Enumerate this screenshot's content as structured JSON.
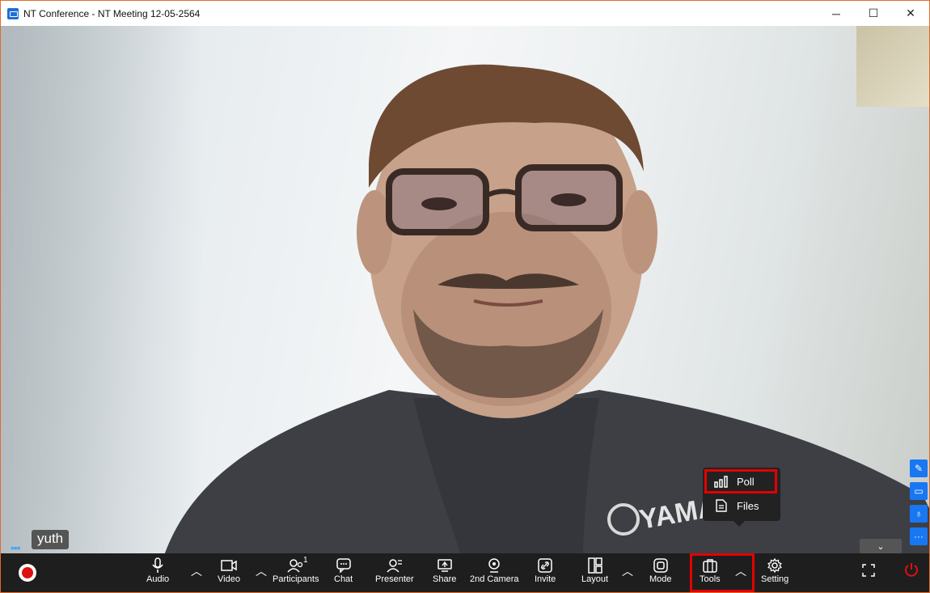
{
  "window": {
    "title": "NT Conference - NT Meeting 12-05-2564",
    "minimize": "─",
    "maximize": "☐",
    "close": "✕"
  },
  "participant": {
    "name": "yuth",
    "indicator": "•••"
  },
  "side_buttons": [
    {
      "name": "pin-icon",
      "glyph": "✎"
    },
    {
      "name": "camera-icon",
      "glyph": "▭"
    },
    {
      "name": "mic-icon",
      "glyph": "♁"
    },
    {
      "name": "more-icon",
      "glyph": "···"
    }
  ],
  "collapse_label": "⌄",
  "tools_menu": {
    "items": [
      {
        "label": "Poll",
        "icon": "bar-chart-icon"
      },
      {
        "label": "Files",
        "icon": "file-icon"
      }
    ]
  },
  "toolbar": {
    "audio": "Audio",
    "video": "Video",
    "participants": "Participants",
    "participants_count": "1",
    "chat": "Chat",
    "presenter": "Presenter",
    "share": "Share",
    "second_camera": "2nd Camera",
    "invite": "Invite",
    "layout": "Layout",
    "mode": "Mode",
    "tools": "Tools",
    "setting": "Setting"
  },
  "colors": {
    "accent": "#1877f2",
    "highlight": "#e30000",
    "toolbar_bg": "#1e1e1e",
    "record": "#e01010"
  }
}
